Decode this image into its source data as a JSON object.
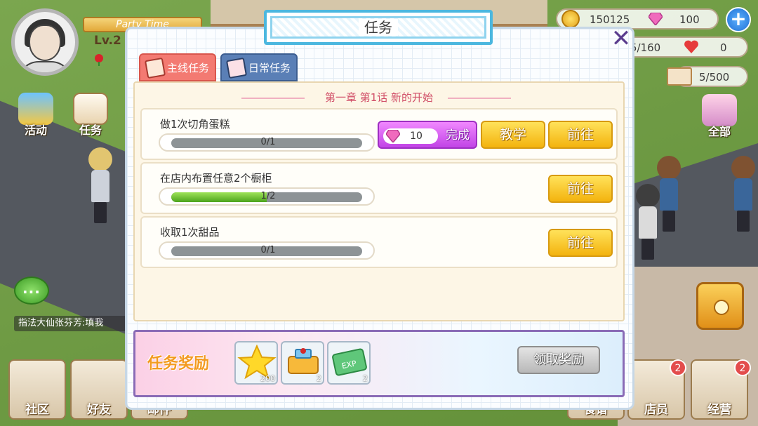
{
  "player": {
    "banner": "Party Time",
    "level": "Lv.2"
  },
  "resources": {
    "coins": "150125",
    "gems": "100",
    "energy": "5/160",
    "hearts": "0",
    "books": "5/500"
  },
  "side_menu": {
    "activity": "活动",
    "task": "任务",
    "all": "全部"
  },
  "chat": {
    "bubble": "···",
    "message": "指法大仙张芬芳:填我"
  },
  "bottom_bar": {
    "community": "社区",
    "friends": "好友",
    "mail": "邮件",
    "dessert": "食谱",
    "staff": "店员",
    "staff_badge": "2",
    "manage": "经营",
    "manage_badge": "2"
  },
  "modal": {
    "title": "任务",
    "close": "✕",
    "tabs": {
      "main": "主线任务",
      "daily": "日常任务"
    },
    "chapter": "第一章  第1话  新的开始",
    "tasks": [
      {
        "name": "做1次切角蛋糕",
        "progress_text": "0/1",
        "progress": 0,
        "reward_gems": "10",
        "complete_label": "完成",
        "teach_label": "教学",
        "go_label": "前往"
      },
      {
        "name": "在店内布置任意2个橱柜",
        "progress_text": "1/2",
        "progress": 0.5,
        "go_label": "前往"
      },
      {
        "name": "收取1次甜品",
        "progress_text": "0/1",
        "progress": 0,
        "go_label": "前往"
      }
    ],
    "reward": {
      "label": "任务奖励",
      "items": [
        {
          "icon": "star-icon",
          "count": "200"
        },
        {
          "icon": "cash-register-icon",
          "count": "2"
        },
        {
          "icon": "exp-card-icon",
          "count": "2"
        }
      ],
      "claim_label": "领取奖励"
    }
  },
  "colors": {
    "tab_main": "#f37a72",
    "tab_daily": "#5a7fb6",
    "go_button": "#f3b30e",
    "complete_button": "#c144e6",
    "claim_disabled": "#b8b8b8"
  }
}
